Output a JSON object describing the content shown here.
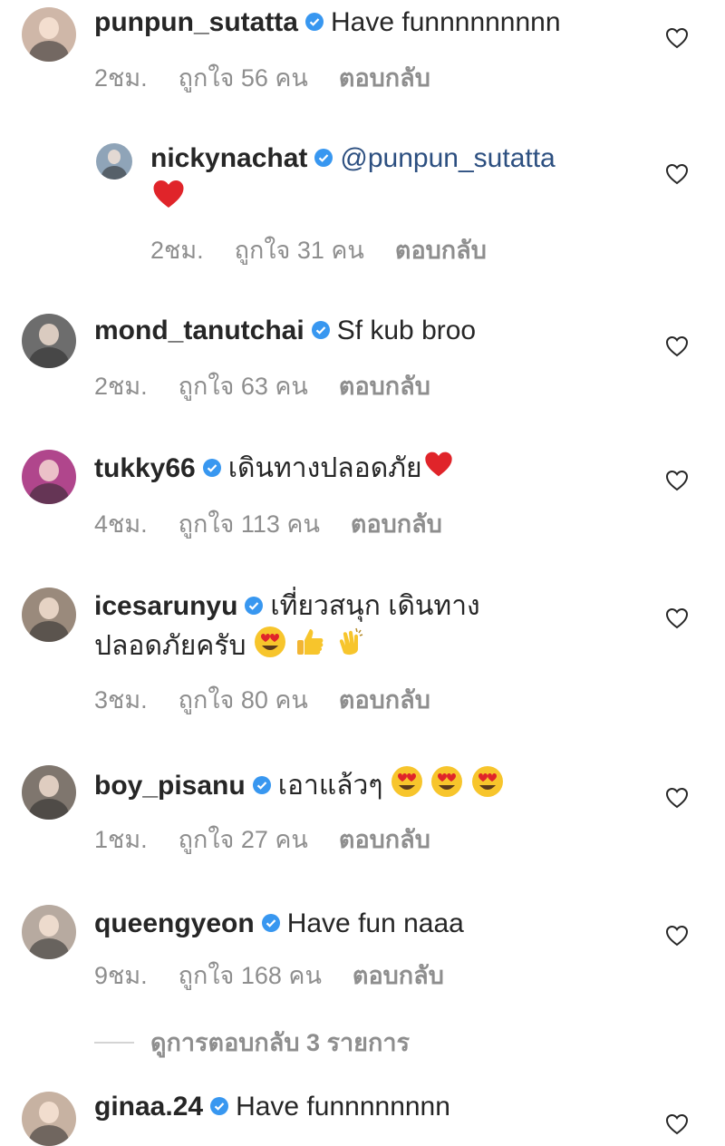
{
  "comments": [
    {
      "username": "punpun_sutatta",
      "text": "Have funnnnnnnnn",
      "time": "2ชม.",
      "likes": "ถูกใจ 56 คน",
      "reply_label": "ตอบกลับ",
      "avatar_color": "#cfb7a8"
    },
    {
      "username": "nickynachat",
      "mention": "@punpun_sutatta",
      "time": "2ชม.",
      "likes": "ถูกใจ 31 คน",
      "reply_label": "ตอบกลับ",
      "avatar_color": "#8fa4b8",
      "emojis": [
        "red-heart"
      ]
    },
    {
      "username": "mond_tanutchai",
      "text": "Sf kub broo",
      "time": "2ชม.",
      "likes": "ถูกใจ 63 คน",
      "reply_label": "ตอบกลับ",
      "avatar_color": "#6d6d6d"
    },
    {
      "username": "tukky66",
      "text": "เดินทางปลอดภัย",
      "time": "4ชม.",
      "likes": "ถูกใจ 113 คน",
      "reply_label": "ตอบกลับ",
      "avatar_color": "#b0468c",
      "emojis": [
        "red-heart"
      ]
    },
    {
      "username": "icesarunyu",
      "text": "เที่ยวสนุก เดินทาง",
      "text2": "ปลอดภัยครับ",
      "time": "3ชม.",
      "likes": "ถูกใจ 80 คน",
      "reply_label": "ตอบกลับ",
      "avatar_color": "#9a8a7c",
      "emojis": [
        "heart-eyes",
        "thumbs-up",
        "clapping-hands"
      ]
    },
    {
      "username": "boy_pisanu",
      "text": "เอาแล้วๆ",
      "time": "1ชม.",
      "likes": "ถูกใจ 27 คน",
      "reply_label": "ตอบกลับ",
      "avatar_color": "#7f766e",
      "emojis": [
        "heart-eyes",
        "heart-eyes",
        "heart-eyes"
      ]
    },
    {
      "username": "queengyeon",
      "text": "Have fun naaa",
      "time": "9ชม.",
      "likes": "ถูกใจ 168 คน",
      "reply_label": "ตอบกลับ",
      "avatar_color": "#b7aaa0"
    },
    {
      "username": "ginaa.24",
      "text": "Have funnnnnnnn",
      "avatar_color": "#c7b2a2"
    }
  ],
  "view_replies": "ดูการตอบกลับ 3 รายการ",
  "colors": {
    "verified_blue": "#3897f0",
    "meta_gray": "#8e8e8e",
    "mention_blue": "#2c4f80"
  }
}
